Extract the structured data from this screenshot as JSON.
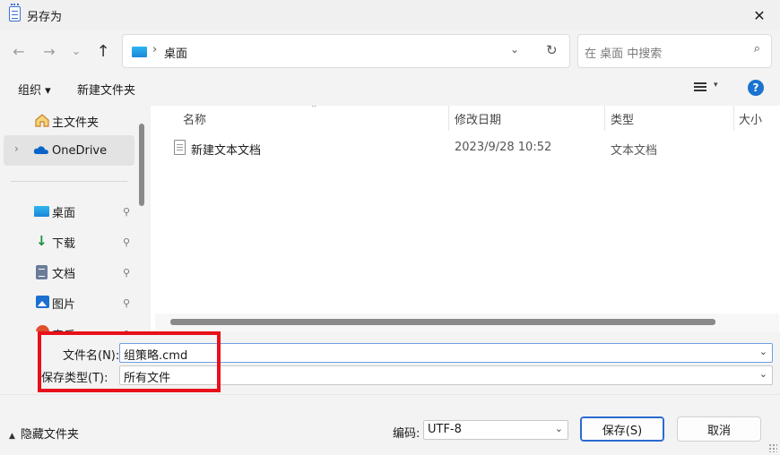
{
  "window": {
    "title": "另存为",
    "close_glyph": "✕"
  },
  "nav": {
    "back_glyph": "←",
    "forward_glyph": "→",
    "recent_glyph": "⌄",
    "up_glyph": "↑",
    "address": {
      "separator": "›",
      "location": "桌面",
      "dropdown_glyph": "⌄",
      "refresh_glyph": "↻"
    },
    "search": {
      "placeholder": "在 桌面 中搜索",
      "icon_glyph": "⌕"
    }
  },
  "toolbar": {
    "organize_label": "组织 ▾",
    "new_folder_label": "新建文件夹",
    "view_dropdown_glyph": "▾",
    "help_glyph": "?"
  },
  "sidebar": {
    "items": [
      {
        "label": "主文件夹",
        "icon": "home-icon"
      },
      {
        "label": "OneDrive",
        "icon": "onedrive-icon",
        "selected": true,
        "expand_glyph": "›"
      },
      {
        "label": "桌面",
        "icon": "desktop-icon",
        "pinned": true
      },
      {
        "label": "下载",
        "icon": "download-icon",
        "pinned": true
      },
      {
        "label": "文档",
        "icon": "documents-icon",
        "pinned": true
      },
      {
        "label": "图片",
        "icon": "pictures-icon",
        "pinned": true
      },
      {
        "label": "音乐",
        "icon": "music-icon",
        "pinned": true
      }
    ],
    "pin_glyph": "📌"
  },
  "columns": {
    "name": "名称",
    "modified": "修改日期",
    "type": "类型",
    "size": "大小",
    "sort_glyph": "⌃"
  },
  "files": [
    {
      "name": "新建文本文档",
      "modified": "2023/9/28 10:52",
      "type": "文本文档"
    }
  ],
  "form": {
    "filename_label": "文件名(N):",
    "filename_value": "组策略.cmd",
    "filetype_label": "保存类型(T):",
    "filetype_value": "所有文件",
    "dropdown_glyph": "⌄"
  },
  "footer": {
    "hide_folders_glyph": "▲",
    "hide_folders_label": "隐藏文件夹",
    "encoding_label": "编码:",
    "encoding_value": "UTF-8",
    "save_label": "保存(S)",
    "cancel_label": "取消"
  },
  "colors": {
    "accent": "#1a73d0",
    "highlight_box": "#e8101a"
  }
}
